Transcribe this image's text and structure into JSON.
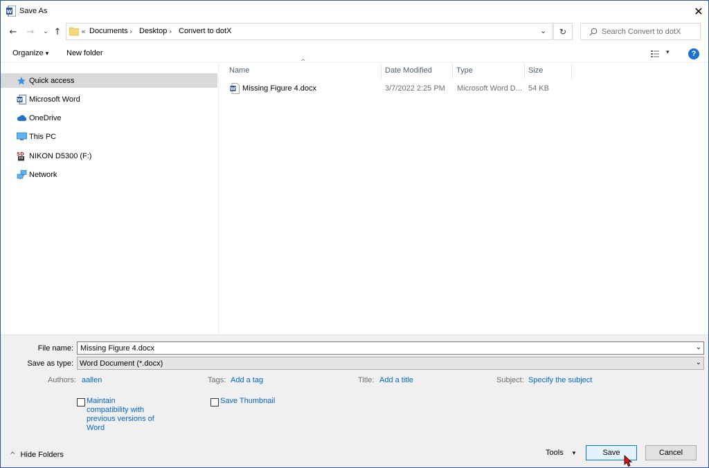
{
  "window": {
    "title": "Save As",
    "close_glyph": "✕"
  },
  "nav": {
    "back_glyph": "←",
    "forward_glyph": "→",
    "recent_glyph": "⌄",
    "up_glyph": "↑",
    "breadcrumb_overflow": "«",
    "breadcrumbs": [
      "Documents",
      "Desktop",
      "Convert to dotX"
    ],
    "separator": "›",
    "address_dropdown_glyph": "⌄",
    "refresh_glyph": "↻",
    "search_placeholder": "Search Convert to dotX"
  },
  "toolbar": {
    "organize_label": "Organize",
    "organize_arrow": "▾",
    "new_folder_label": "New folder",
    "view_arrow": "▾",
    "help_label": "?"
  },
  "sidebar": {
    "items": [
      {
        "label": "Quick access",
        "icon": "star-icon",
        "selected": true
      },
      {
        "label": "Microsoft Word",
        "icon": "word-icon"
      },
      {
        "label": "OneDrive",
        "icon": "cloud-icon"
      },
      {
        "label": "This PC",
        "icon": "monitor-icon"
      },
      {
        "label": "NIKON D5300 (F:)",
        "icon": "sd-card-icon"
      },
      {
        "label": "Network",
        "icon": "network-icon"
      }
    ]
  },
  "filelist": {
    "sort_glyph": "^",
    "columns": [
      "Name",
      "Date Modified",
      "Type",
      "Size"
    ],
    "rows": [
      {
        "name": "Missing Figure 4.docx",
        "date": "3/7/2022 2:25 PM",
        "type": "Microsoft Word D...",
        "size": "54 KB"
      }
    ]
  },
  "form": {
    "filename_label": "File name:",
    "filename_value": "Missing Figure 4.docx",
    "savetype_label": "Save as type:",
    "savetype_value": "Word Document (*.docx)",
    "dropdown_glyph": "⌄",
    "authors_label": "Authors:",
    "authors_value": "aallen",
    "tags_label": "Tags:",
    "tags_value": "Add a tag",
    "title_label": "Title:",
    "title_value": "Add a title",
    "subject_label": "Subject:",
    "subject_value": "Specify the subject",
    "compat_lines": [
      "Maintain",
      "compatibility with",
      "previous versions of",
      "Word"
    ],
    "thumbnail_label": "Save Thumbnail"
  },
  "footer": {
    "hide_folders_glyph": "^",
    "hide_folders_label": "Hide Folders",
    "tools_label": "Tools",
    "tools_arrow": "▾",
    "save_label": "Save",
    "cancel_label": "Cancel"
  },
  "colors": {
    "accent": "#0078d7",
    "link": "#0066cc",
    "selected_bg": "#d9d9d9",
    "panel_bg": "#f0f0f0",
    "word_blue": "#2b579a"
  }
}
